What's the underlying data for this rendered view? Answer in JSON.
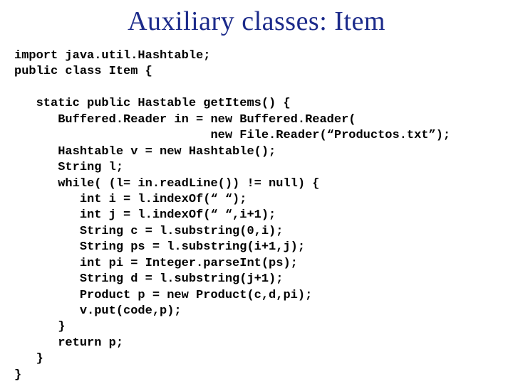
{
  "title": "Auxiliary classes: Item",
  "code": "import java.util.Hashtable;\npublic class Item {\n\n   static public Hastable getItems() {\n      Buffered.Reader in = new Buffered.Reader(\n                           new File.Reader(“Productos.txt”);\n      Hashtable v = new Hashtable();\n      String l;\n      while( (l= in.readLine()) != null) {\n         int i = l.indexOf(“ “);\n         int j = l.indexOf(“ “,i+1);\n         String c = l.substring(0,i);\n         String ps = l.substring(i+1,j);\n         int pi = Integer.parseInt(ps);\n         String d = l.substring(j+1);\n         Product p = new Product(c,d,pi);\n         v.put(code,p);\n      }\n      return p;\n   }\n}"
}
